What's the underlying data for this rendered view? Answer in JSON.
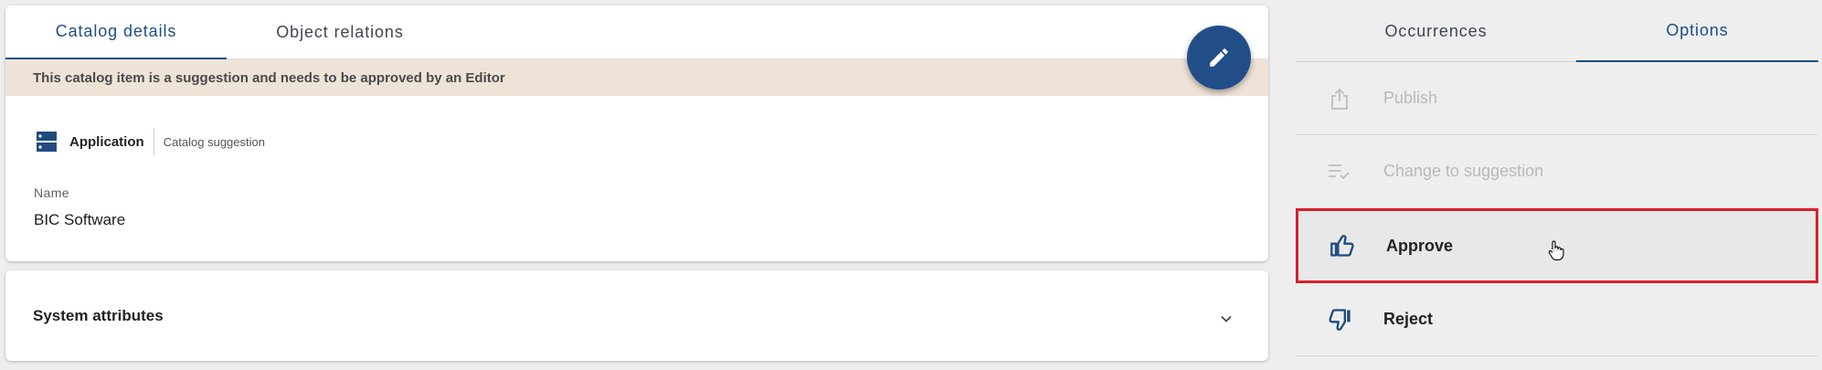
{
  "tabs_left": [
    "Catalog details",
    "Object relations"
  ],
  "banner": "This catalog item is a suggestion and needs to be approved by an Editor",
  "item": {
    "type_name": "Application",
    "type_sub": "Catalog suggestion",
    "field_label": "Name",
    "field_value": "BIC Software"
  },
  "system_attributes": "System attributes",
  "tabs_right": [
    "Occurrences",
    "Options"
  ],
  "options": [
    {
      "label": "Publish",
      "icon": "share-icon",
      "state": "disabled"
    },
    {
      "label": "Change to suggestion",
      "icon": "list-check-icon",
      "state": "disabled"
    },
    {
      "label": "Approve",
      "icon": "thumbs-up-icon",
      "state": "highlighted"
    },
    {
      "label": "Reject",
      "icon": "thumbs-down-icon",
      "state": "enabled"
    }
  ],
  "colors": {
    "accent": "#1c4e89",
    "fab": "#224e88",
    "banner": "#eee3d6",
    "highlight_border": "#d7212a"
  }
}
